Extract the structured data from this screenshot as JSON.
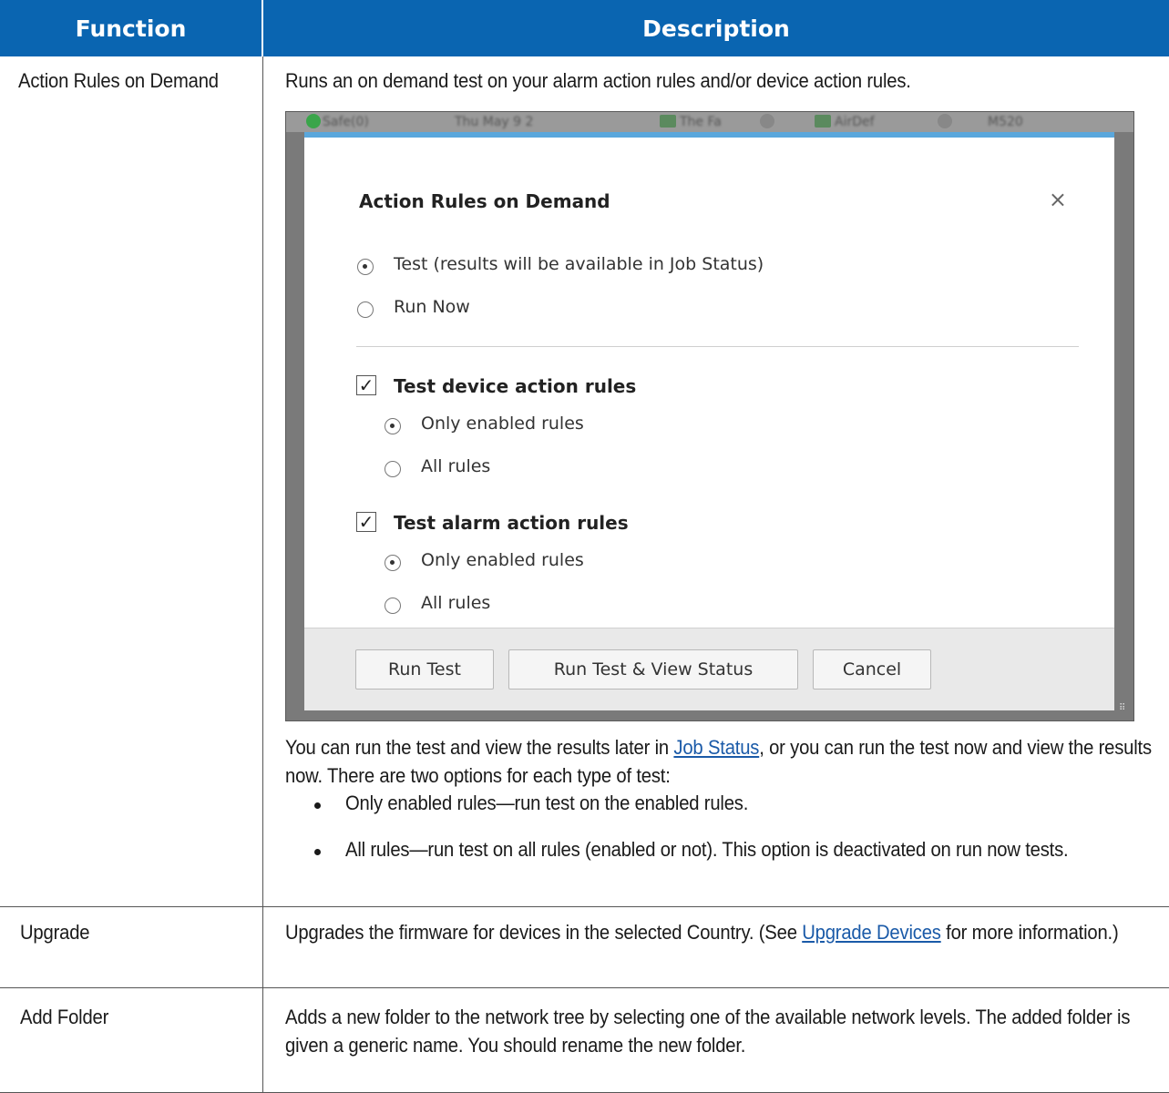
{
  "table": {
    "headers": {
      "function": "Function",
      "description": "Description"
    },
    "rows": [
      {
        "function": "Action Rules on Demand",
        "description_intro": "Runs an on demand test on your alarm action rules and/or device action rules.",
        "para": {
          "before_link": "You can run the test and view the results later in ",
          "link": "Job Status",
          "after_link": ", or you can run the test now and view the results now. There are two options for each type of test:"
        },
        "bullets": [
          "Only enabled rules—run test on the enabled rules.",
          "All rules—run test on all rules (enabled or not). This option is deactivated on run now tests."
        ]
      },
      {
        "function": "Upgrade",
        "before_link": "Upgrades the firmware for devices in the selected Country. (See ",
        "link": "Upgrade Devices",
        "after_link": " for more information.)"
      },
      {
        "function": "Add Folder",
        "description": "Adds a new folder to the network tree by selecting one of the available network levels. The added folder is given a generic name. You should rename the new folder."
      }
    ]
  },
  "screenshot": {
    "background_strip": [
      "Safe(0)",
      "Thu May 9 2",
      "The Fa",
      "AirDef",
      "M520"
    ],
    "dialog": {
      "title": "Action Rules on Demand",
      "close": "×",
      "mode_options": [
        "Test (results will be available in Job Status)",
        "Run Now"
      ],
      "mode_selected": 0,
      "device_rules": {
        "label": "Test device action rules",
        "checked": true,
        "options": [
          "Only enabled rules",
          "All rules"
        ],
        "selected": 0
      },
      "alarm_rules": {
        "label": "Test alarm action rules",
        "checked": true,
        "options": [
          "Only enabled rules",
          "All rules"
        ],
        "selected": 0
      },
      "buttons": [
        "Run Test",
        "Run Test & View Status",
        "Cancel"
      ]
    }
  },
  "colors": {
    "header_bg": "#0a65b1",
    "dialog_accent": "#5aa7dc",
    "link": "#1a5aa8"
  }
}
